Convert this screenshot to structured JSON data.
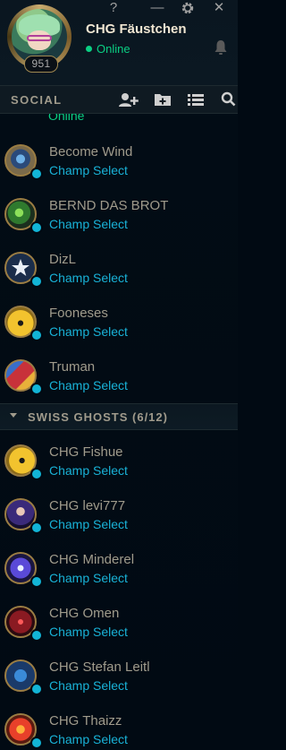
{
  "header": {
    "username": "CHG Fäustchen",
    "status": "Online",
    "level": "951",
    "top_icons": [
      "help-icon",
      "minimize-icon",
      "settings-icon",
      "close-icon"
    ],
    "help_glyph": "?",
    "minimize_glyph": "—",
    "close_glyph": "✕"
  },
  "social_bar": {
    "label": "SOCIAL",
    "icons": [
      "add-friend-icon",
      "add-folder-icon",
      "list-view-icon",
      "search-icon"
    ]
  },
  "list": {
    "peek_text": "Online",
    "group_label": "SWISS GHOSTS (6/12)",
    "friends_top": [
      {
        "name": "Become Wind",
        "status": "Champ Select"
      },
      {
        "name": "BERND DAS BROT",
        "status": "Champ Select"
      },
      {
        "name": "DizL",
        "status": "Champ Select"
      },
      {
        "name": "Fooneses",
        "status": "Champ Select"
      },
      {
        "name": "Truman",
        "status": "Champ Select"
      }
    ],
    "friends_group": [
      {
        "name": "CHG Fishue",
        "status": "Champ Select"
      },
      {
        "name": "CHG levi777",
        "status": "Champ Select"
      },
      {
        "name": "CHG Minderel",
        "status": "Champ Select"
      },
      {
        "name": "CHG Omen",
        "status": "Champ Select"
      },
      {
        "name": "CHG Stefan Leitl",
        "status": "Champ Select"
      },
      {
        "name": "CHG Thaizz",
        "status": "Champ Select"
      }
    ]
  },
  "colors": {
    "background": "#010a13",
    "gold": "#c8aa6e",
    "name_text": "#a09b8c",
    "online_green": "#0acf83",
    "champ_select_blue": "#19b2d7"
  }
}
